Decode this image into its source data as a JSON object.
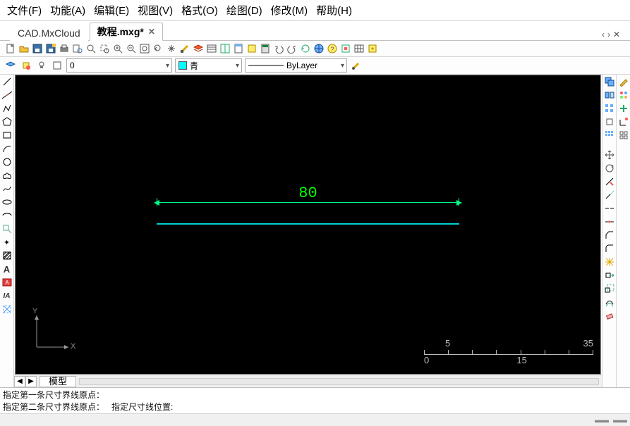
{
  "menubar": {
    "file": "文件(F)",
    "function": "功能(A)",
    "edit": "编辑(E)",
    "view": "视图(V)",
    "format": "格式(O)",
    "draw": "绘图(D)",
    "modify": "修改(M)",
    "help": "帮助(H)"
  },
  "tabs": {
    "tab1": "CAD.MxCloud",
    "tab2": "教程.mxg*"
  },
  "tabbar_actions": {
    "prev": "‹",
    "next": "›",
    "close": "✕"
  },
  "property_bar": {
    "layer_value": "0",
    "color_value": "青",
    "linetype_value": "ByLayer"
  },
  "canvas": {
    "dimension_value": "80",
    "ucs_x": "X",
    "ucs_y": "Y"
  },
  "ruler": {
    "v0": "0",
    "v5": "5",
    "v15": "15",
    "v35": "35"
  },
  "model_tab": "模型",
  "nav": {
    "prev": "◀",
    "next": "▶"
  },
  "command": {
    "line1": "指定第一条尺寸界线原点：",
    "line2a": "指定第二条尺寸界线原点：",
    "line2b": "指定尺寸线位置:"
  },
  "chart_data": {
    "type": "table",
    "title": "CAD canvas drawn content",
    "objects": [
      {
        "kind": "line",
        "color": "cyan",
        "length_units": 80
      },
      {
        "kind": "linear_dimension",
        "value": 80,
        "text_color": "green"
      }
    ],
    "axes": {
      "x": "X",
      "y": "Y"
    },
    "ruler_ticks": [
      0,
      5,
      15,
      35
    ]
  }
}
